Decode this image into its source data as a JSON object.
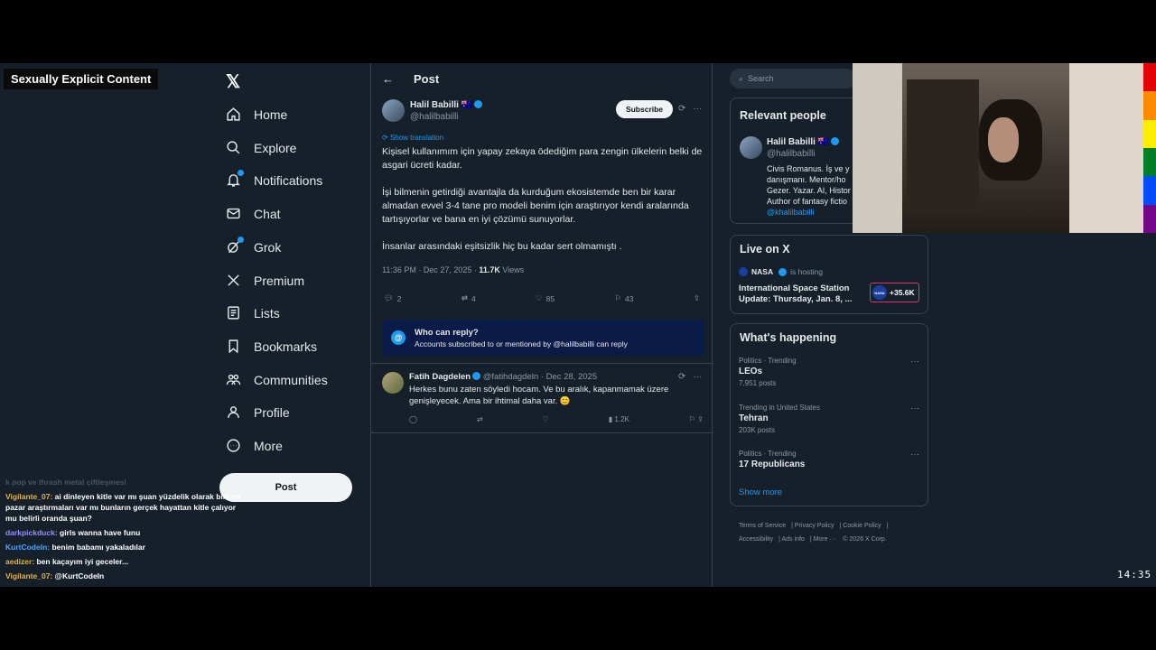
{
  "overlay": {
    "content_label": "Sexually Explicit Content",
    "clock": "14:35"
  },
  "nav": {
    "items": [
      {
        "label": "Home",
        "icon": "home-icon"
      },
      {
        "label": "Explore",
        "icon": "search-icon"
      },
      {
        "label": "Notifications",
        "icon": "bell-icon"
      },
      {
        "label": "Chat",
        "icon": "mail-icon"
      },
      {
        "label": "Grok",
        "icon": "grok-icon"
      },
      {
        "label": "Premium",
        "icon": "x-logo-icon"
      },
      {
        "label": "Lists",
        "icon": "list-icon"
      },
      {
        "label": "Bookmarks",
        "icon": "bookmark-icon"
      },
      {
        "label": "Communities",
        "icon": "communities-icon"
      },
      {
        "label": "Profile",
        "icon": "profile-icon"
      },
      {
        "label": "More",
        "icon": "more-icon"
      }
    ],
    "post_label": "Post"
  },
  "chat": {
    "faded_line": "k pop ve thrash metal çiftleşmesi",
    "messages": [
      {
        "user": "Vigilante_07:",
        "text": " ai dinleyen kitle var mı şuan yüzdelik olarak bile mı pazar araştırmaları var mı bunların gerçek hayattan kitle çalıyor mu belirli oranda şuan?"
      },
      {
        "user": "darkpickduck:",
        "text": " girls wanna have funu"
      },
      {
        "user": "KurtCodeIn:",
        "text": " benim babamı yakaladılar"
      },
      {
        "user": "aedizer:",
        "text": " ben kaçayım iyi geceler..."
      },
      {
        "user": "Vigilante_07:",
        "text": " @KurtCodeIn"
      }
    ]
  },
  "post": {
    "header_title": "Post",
    "author_name": "Halil Babilli",
    "author_flag": "🇦🇺",
    "author_handle": "@halilbabilli",
    "subscribe_label": "Subscribe",
    "show_translation": "Show translation",
    "paragraphs": [
      "Kişisel kullanımım için yapay zekaya ödediğim para zengin ülkelerin belki de asgari ücreti kadar.",
      "İşi bilmenin getirdiği avantajla da kurduğum ekosistemde ben bir karar almadan evvel 3-4 tane pro modeli benim için araştırıyor kendi aralarında tartışıyorlar ve bana en iyi çözümü sunuyorlar.",
      "İnsanlar arasındaki eşitsizlik hiç bu kadar sert olmamıştı ."
    ],
    "time": "11:36 PM · Dec 27, 2025 · ",
    "views_count": "11.7K",
    "views_label": " Views",
    "actions": {
      "replies": "2",
      "reposts": "4",
      "likes": "85",
      "bookmarks": "43"
    },
    "who_can_reply_title": "Who can reply?",
    "who_can_reply_text": "Accounts subscribed to or mentioned by @halilbabilli can reply"
  },
  "reply": {
    "name": "Fatih Dagdelen",
    "handle_date": "@fatihdagdeln · Dec 28, 2025",
    "text": "Herkes bunu zaten söyledi hocam. Ve bu aralık, kapanmamak üzere genişleyecek. Ama bir ihtimal daha var. 😊",
    "views": "1.2K"
  },
  "sidebar": {
    "search_placeholder": "Search",
    "relevant_title": "Relevant people",
    "rp_name": "Halil Babilli",
    "rp_flag": "🇦🇺",
    "rp_handle": "@halilbabilli",
    "rp_bio": "Civis Romanus. İş ve y danışmanı. Mentor/ho Gezer. Yazar. AI, Histor Author of fantasy fictio",
    "rp_mention": "@khalilbabilli",
    "live_title": "Live on X",
    "live_host": "NASA",
    "live_hosting": "is hosting",
    "live_event": "International Space Station Update: Thursday, Jan. 8, ...",
    "live_count": "+35.6K",
    "happening_title": "What's happening",
    "trends": [
      {
        "category": "Politics · Trending",
        "title": "LEOs",
        "posts": "7,951 posts"
      },
      {
        "category": "Trending in United States",
        "title": "Tehran",
        "posts": "203K posts"
      },
      {
        "category": "Politics · Trending",
        "title": "17 Republicans",
        "posts": ""
      }
    ],
    "show_more": "Show more",
    "footer": [
      "Terms of Service",
      "Privacy Policy",
      "Cookie Policy",
      "Accessibility",
      "Ads info",
      "More ···",
      "© 2026 X Corp."
    ]
  },
  "colors": {
    "accent": "#1d9bf0",
    "background": "#15202b",
    "border": "#38444d",
    "live_border": "#e8336b"
  }
}
